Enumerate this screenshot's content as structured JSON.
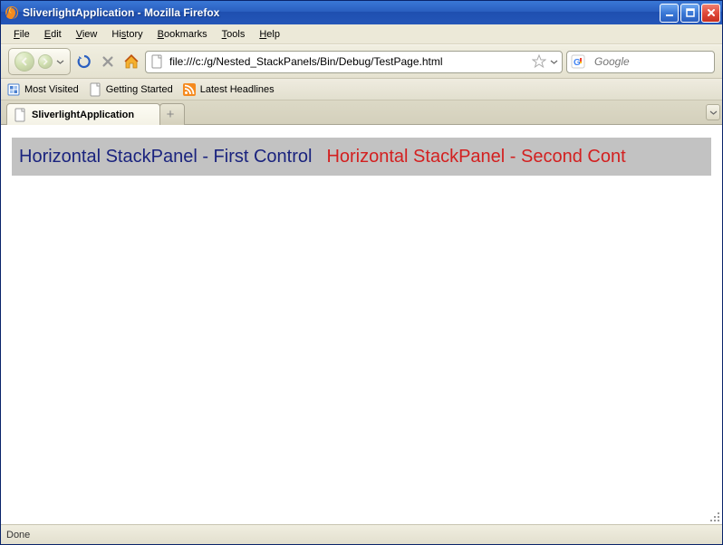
{
  "window": {
    "title": "SliverlightApplication - Mozilla Firefox"
  },
  "menu": {
    "file": "File",
    "edit": "Edit",
    "view": "View",
    "history": "History",
    "bookmarks": "Bookmarks",
    "tools": "Tools",
    "help": "Help"
  },
  "nav": {
    "url": "file:///c:/g/Nested_StackPanels/Bin/Debug/TestPage.html",
    "search_placeholder": "Google"
  },
  "bookmarks": {
    "most_visited": "Most Visited",
    "getting_started": "Getting Started",
    "latest_headlines": "Latest Headlines"
  },
  "tabs": {
    "active": "SliverlightApplication",
    "newtab_glyph": "+"
  },
  "content": {
    "panel1": "Horizontal StackPanel - First Control",
    "panel2": "Horizontal StackPanel - Second Cont"
  },
  "status": {
    "text": "Done"
  }
}
